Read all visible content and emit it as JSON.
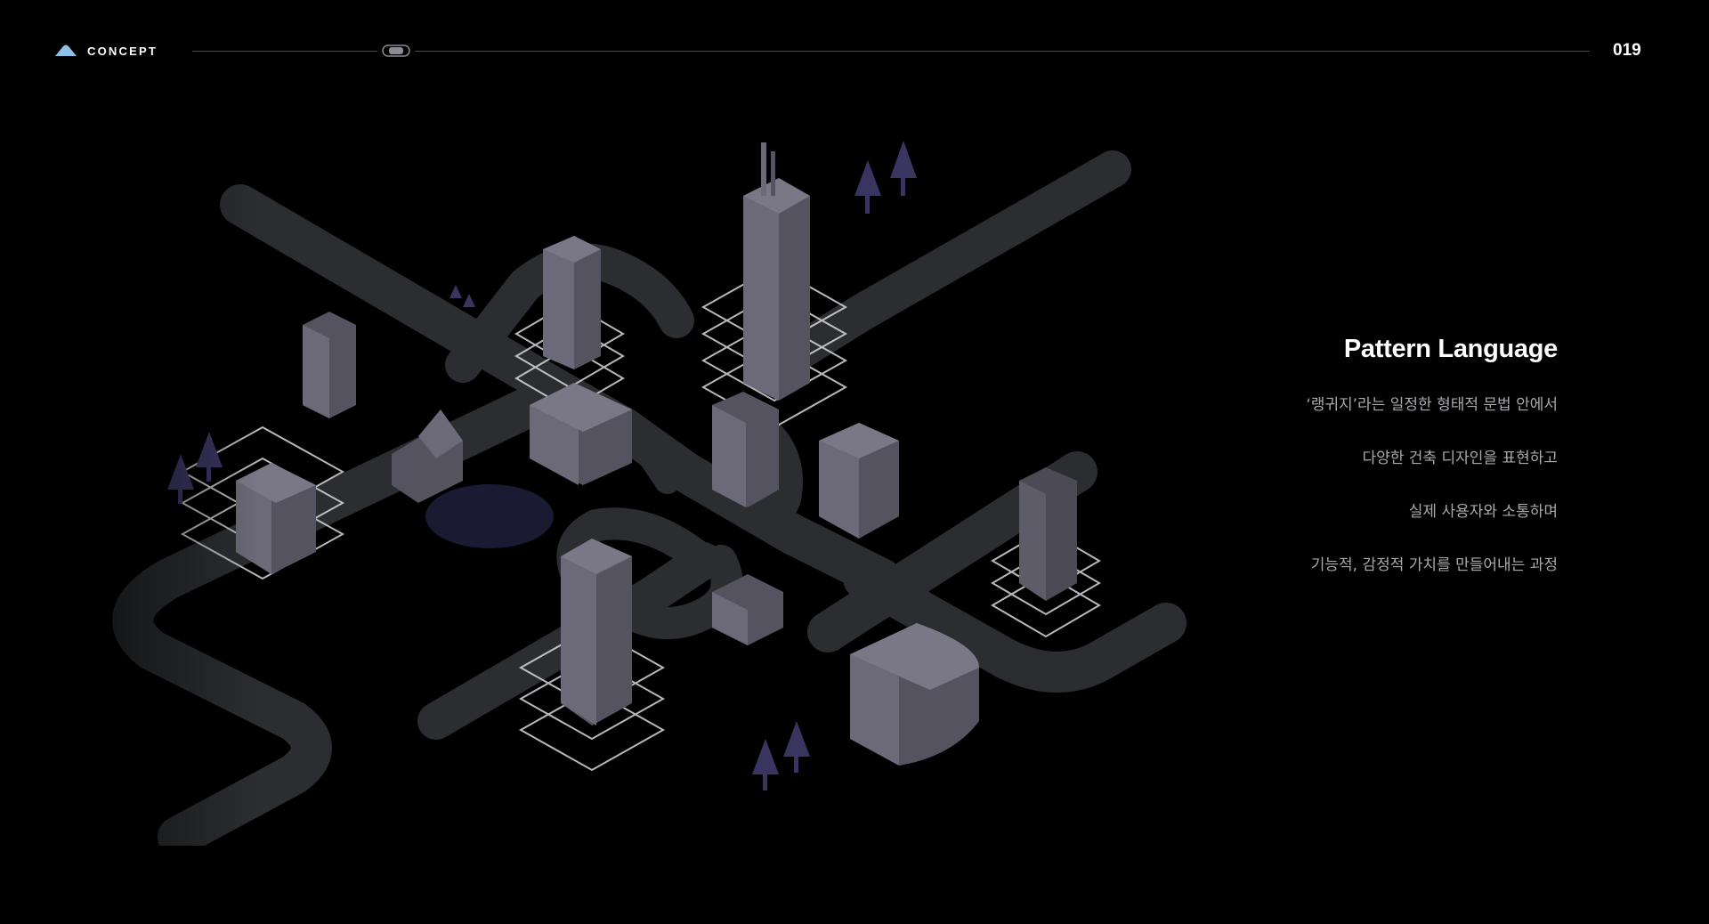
{
  "header": {
    "brand_label": "CONCEPT",
    "page_number": "019"
  },
  "content": {
    "title": "Pattern Language",
    "lines": [
      "‘랭귀지’라는 일정한 형태적 문법 안에서",
      "다양한 건축 디자인을 표현하고",
      "실제 사용자와 소통하며",
      "기능적, 감정적 가치를 만들어내는 과정"
    ]
  },
  "colors": {
    "background": "#000000",
    "road": "#2c2e31",
    "building_light": "#6c6a78",
    "building_mid": "#55535f",
    "building_dark": "#403e4a",
    "tree": "#3a3560",
    "pond": "#1b1a33",
    "accent_logo": "#8fc1e8"
  },
  "icons": {
    "brand": "mountain-logo-icon",
    "progress_marker": "car-icon"
  }
}
